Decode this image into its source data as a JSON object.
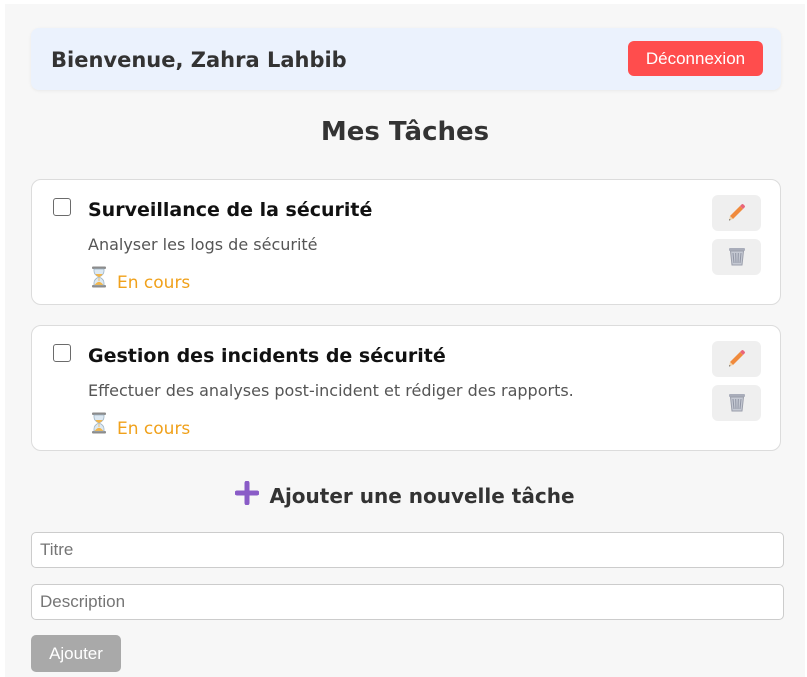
{
  "header": {
    "welcome_text": "Bienvenue, Zahra Lahbib",
    "logout_label": "Déconnexion"
  },
  "page_title": "Mes Tâches",
  "tasks": [
    {
      "title": "Surveillance de la sécurité",
      "description": "Analyser les logs de sécurité",
      "status": "En cours",
      "completed": false
    },
    {
      "title": "Gestion des incidents de sécurité",
      "description": "Effectuer des analyses post-incident et rédiger des rapports.",
      "status": "En cours",
      "completed": false
    }
  ],
  "add_form": {
    "heading": "Ajouter une nouvelle tâche",
    "title_placeholder": "Titre",
    "title_value": "",
    "description_placeholder": "Description",
    "description_value": "",
    "submit_label": "Ajouter"
  },
  "icons": {
    "status": "hourglass-icon",
    "edit": "pencil-icon",
    "delete": "wastebasket-icon",
    "add": "plus-icon"
  },
  "colors": {
    "header_bg": "#ebf2fd",
    "logout_bg": "#ff4d4d",
    "status_text": "#f0a11b",
    "add_icon": "#8a5cc7",
    "submit_bg": "#a9a9a9"
  }
}
